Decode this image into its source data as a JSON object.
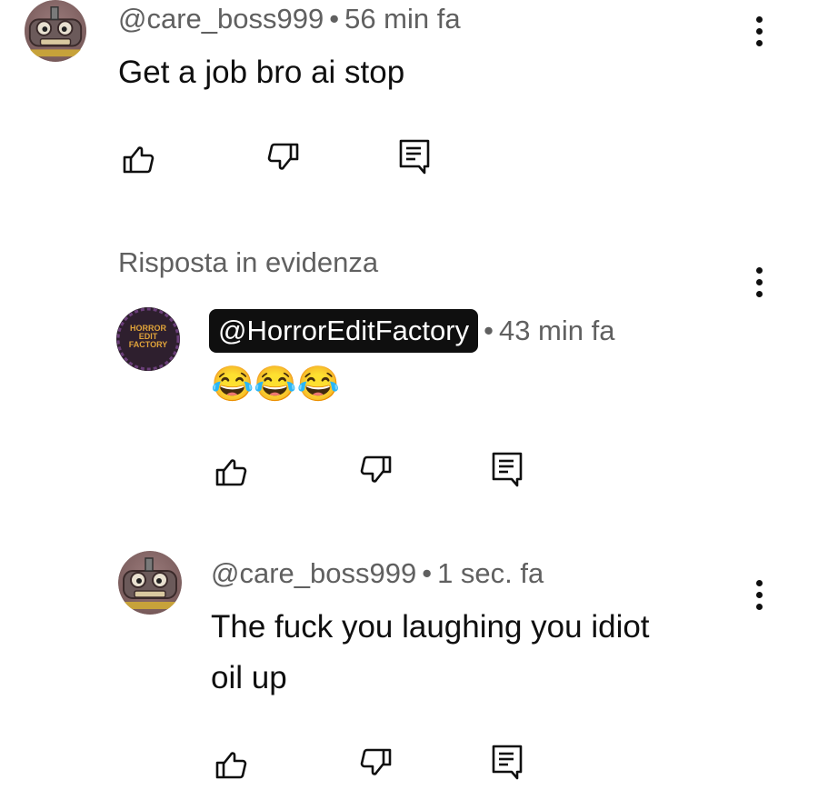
{
  "comment1": {
    "handle": "@care_boss999",
    "time": "56 min fa",
    "text": "Get a job bro ai stop"
  },
  "section": {
    "label": "Risposta in evidenza"
  },
  "reply1": {
    "handle": "@HorrorEditFactory",
    "time": "43 min fa",
    "text": "😂😂😂",
    "avatar_text": "HORROR EDIT FACTORY"
  },
  "reply2": {
    "handle": "@care_boss999",
    "time": "1 sec. fa",
    "text_line1": "The fuck you laughing you idiot",
    "text_line2": "oil up"
  },
  "separator": "•",
  "icons": {
    "like": "thumb-up-icon",
    "dislike": "thumb-down-icon",
    "reply": "comment-reply-icon",
    "more": "more-vert-icon"
  },
  "colors": {
    "text": "#0f0f0f",
    "meta": "#606060",
    "background": "#ffffff",
    "pill": "#0f0f0f"
  }
}
